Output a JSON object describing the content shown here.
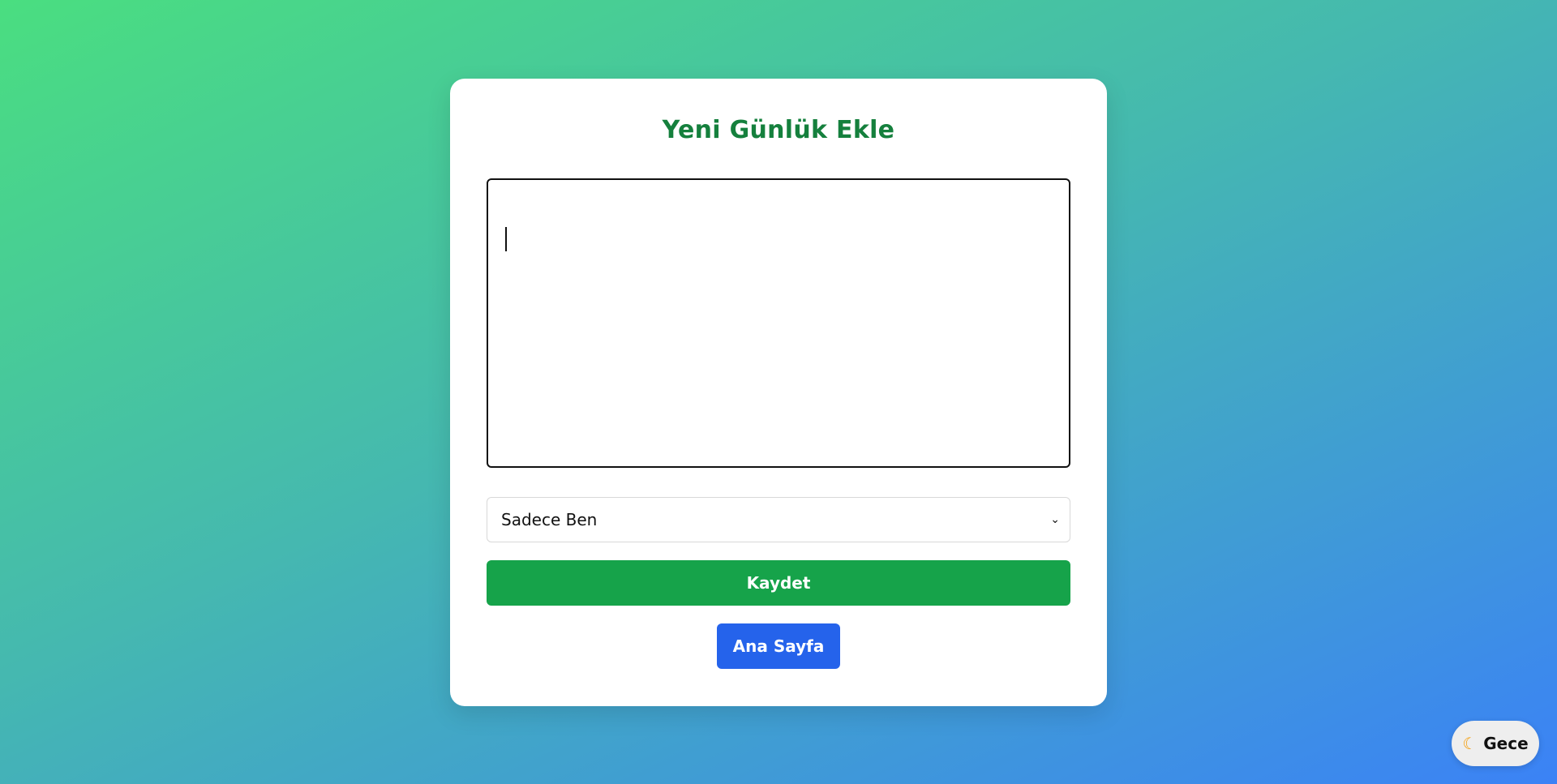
{
  "form": {
    "title": "Yeni Günlük Ekle",
    "content_value": "",
    "visibility_selected": "Sadece Ben",
    "save_label": "Kaydet",
    "home_label": "Ana Sayfa"
  },
  "theme_toggle": {
    "icon": "moon-icon",
    "label": "Gece"
  },
  "colors": {
    "title": "#15803d",
    "save_button": "#16a34a",
    "home_button": "#2563eb"
  }
}
